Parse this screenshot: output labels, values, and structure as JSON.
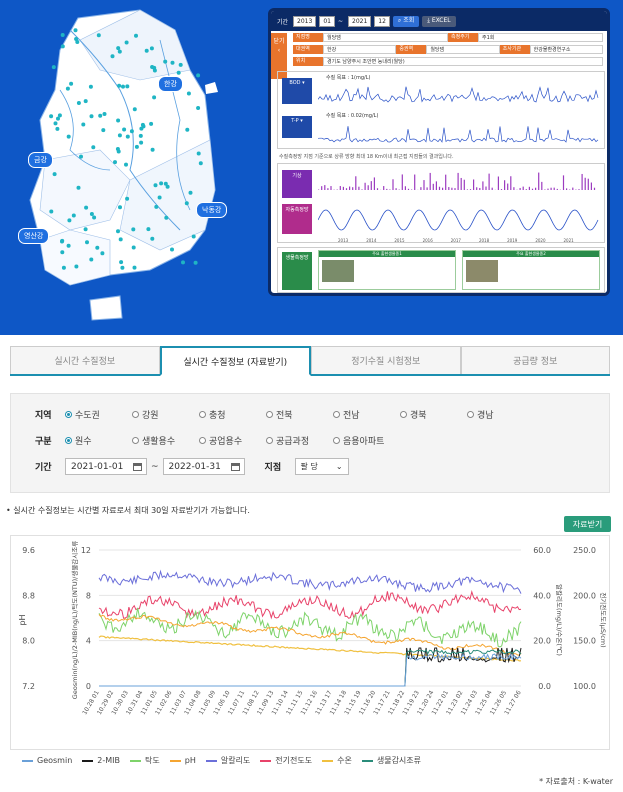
{
  "map": {
    "regions": [
      "한강",
      "금강",
      "낙동강",
      "영산강"
    ]
  },
  "panel": {
    "period_label": "기간",
    "year_from": "2013",
    "month_from": "01",
    "year_to": "2021",
    "month_to": "12",
    "search_btn": "조회",
    "excel_btn": "EXCEL",
    "side_tab": "닫기",
    "info": [
      {
        "k1": "지점명",
        "v1": "월당댐",
        "k2": "측정주기",
        "v2": "주1회"
      },
      {
        "k1": "대권역",
        "v1": "한강",
        "k2": "중권역",
        "v2": "월당댐",
        "k3": "조사기관",
        "v3": "한강물환경연구소"
      },
      {
        "k1": "위치",
        "v1": "경기도 남양주시 조안면 능내리(월당)"
      }
    ],
    "bod_select": "BOD",
    "tp_select": "T-P",
    "bod_value": "수질 목표 : 1(mg/L)",
    "tp_value": "수질 목표 : 0.02(mg/L)",
    "note": "수질측정망 지점 기준으로 상류 방향 최대 18 Km이내 최근접 지점들의 결과입니다.",
    "rain_tag": "기상",
    "flow_tag": "자동측정망",
    "years": [
      "2013",
      "2014",
      "2015",
      "2016",
      "2017",
      "2018",
      "2019",
      "2020",
      "2021"
    ],
    "eco_tag": "생물측정망",
    "species1_title": "주요 출현생물종1",
    "species2_title": "주요 출현생물종2"
  },
  "tabs": [
    {
      "label": "실시간 수질정보"
    },
    {
      "label": "실시간 수질정보 (자료받기)"
    },
    {
      "label": "정기수질 시험정보"
    },
    {
      "label": "공급량 정보"
    }
  ],
  "filter": {
    "region_label": "지역",
    "regions": [
      "수도권",
      "강원",
      "충청",
      "전북",
      "전남",
      "경북",
      "경남"
    ],
    "type_label": "구분",
    "types": [
      "원수",
      "생활용수",
      "공업용수",
      "공급과정",
      "음용아파트"
    ],
    "period_label": "기간",
    "date_from": "2021-01-01",
    "date_sep": "~",
    "date_to": "2022-01-31",
    "site_label": "지점",
    "site_value": "팔 당"
  },
  "notice": "• 실시간 수질정보는 시간별 자료로서 최대 30일 자료받기가 가능합니다.",
  "download_btn": "자료받기",
  "chart_data": {
    "type": "line",
    "left_axis_label": "pH",
    "left_ticks": [
      "9.6",
      "8.8",
      "8.0",
      "7.2"
    ],
    "left2_axis_label": "Geosmin(ng/L)/2-MIB(ng/L)/탁도(NTU)/생물감시조류",
    "left2_ticks": [
      "12",
      "8",
      "4",
      "0"
    ],
    "right_axis_label": "알칼리도(mg/L)/수온(℃)",
    "right_ticks": [
      "60.0",
      "40.0",
      "20.0",
      "0.0"
    ],
    "right2_axis_label": "전기전도도(μS/cm)",
    "right2_ticks": [
      "250.0",
      "200.0",
      "150.0",
      "100.0"
    ],
    "x_labels": [
      "10.28 01",
      "10.29 02",
      "10.30 03",
      "10.31 04",
      "11.01 05",
      "11.02 06",
      "11.03 07",
      "11.04 08",
      "11.05 09",
      "11.06 10",
      "11.07 11",
      "11.08 12",
      "11.09 13",
      "11.10 14",
      "11.11 15",
      "11.12 16",
      "11.13 17",
      "11.14 18",
      "11.15 19",
      "11.16 20",
      "11.17 21",
      "11.18 22",
      "11.19 23",
      "11.20 24",
      "11.22 01",
      "11.23 02",
      "11.24 03",
      "11.25 04",
      "11.26 05",
      "11.27 06"
    ],
    "series": [
      {
        "name": "Geosmin",
        "color": "#6aa0d8"
      },
      {
        "name": "2-MIB",
        "color": "#1a1a1a"
      },
      {
        "name": "탁도",
        "color": "#7ed36a"
      },
      {
        "name": "pH",
        "color": "#f5a531"
      },
      {
        "name": "알칼리도",
        "color": "#6b6fd9"
      },
      {
        "name": "전기전도도",
        "color": "#e8436a"
      },
      {
        "name": "수온",
        "color": "#f0c040"
      },
      {
        "name": "생물감시조류",
        "color": "#2a8c7a"
      }
    ]
  },
  "source": "* 자료출처 : K-water"
}
